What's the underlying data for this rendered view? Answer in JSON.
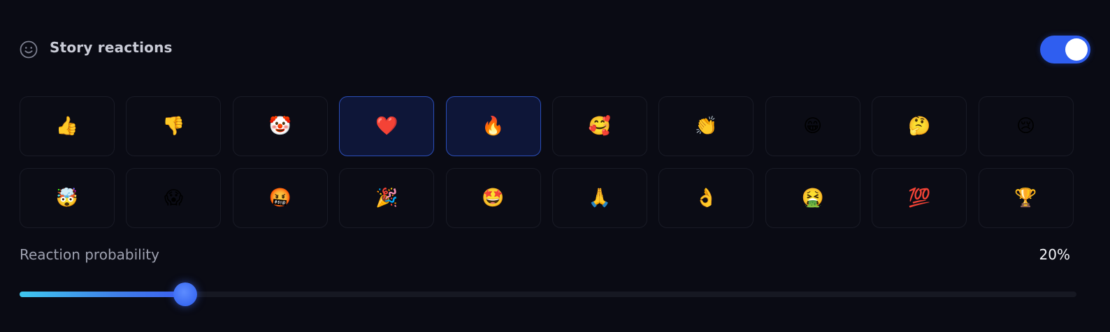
{
  "header": {
    "icon": "smile-icon",
    "title": "Story reactions",
    "toggle_on": true,
    "accent": "#2f5ef0"
  },
  "reactions": [
    {
      "emoji": "👍",
      "name": "thumbs-up",
      "selected": false
    },
    {
      "emoji": "👎",
      "name": "thumbs-down",
      "selected": false
    },
    {
      "emoji": "🤡",
      "name": "clown",
      "selected": false
    },
    {
      "emoji": "❤️",
      "name": "heart",
      "selected": true
    },
    {
      "emoji": "🔥",
      "name": "fire",
      "selected": true
    },
    {
      "emoji": "🥰",
      "name": "smiling-with-hearts",
      "selected": false
    },
    {
      "emoji": "👏",
      "name": "clap",
      "selected": false
    },
    {
      "emoji": "😁",
      "name": "grin",
      "selected": false
    },
    {
      "emoji": "🤔",
      "name": "thinking",
      "selected": false
    },
    {
      "emoji": "😢",
      "name": "crying",
      "selected": false
    },
    {
      "emoji": "🤯",
      "name": "mind-blown",
      "selected": false
    },
    {
      "emoji": "😱",
      "name": "scream",
      "selected": false
    },
    {
      "emoji": "🤬",
      "name": "cursing",
      "selected": false
    },
    {
      "emoji": "🎉",
      "name": "party-popper",
      "selected": false
    },
    {
      "emoji": "🤩",
      "name": "star-struck",
      "selected": false
    },
    {
      "emoji": "🙏",
      "name": "folded-hands",
      "selected": false
    },
    {
      "emoji": "👌",
      "name": "ok-hand",
      "selected": false
    },
    {
      "emoji": "🤮",
      "name": "vomiting",
      "selected": false
    },
    {
      "emoji": "💯",
      "name": "hundred",
      "selected": false
    },
    {
      "emoji": "🏆",
      "name": "trophy",
      "selected": false
    }
  ],
  "probability": {
    "label": "Reaction probability",
    "value_text": "20%",
    "fraction": 0.157
  }
}
